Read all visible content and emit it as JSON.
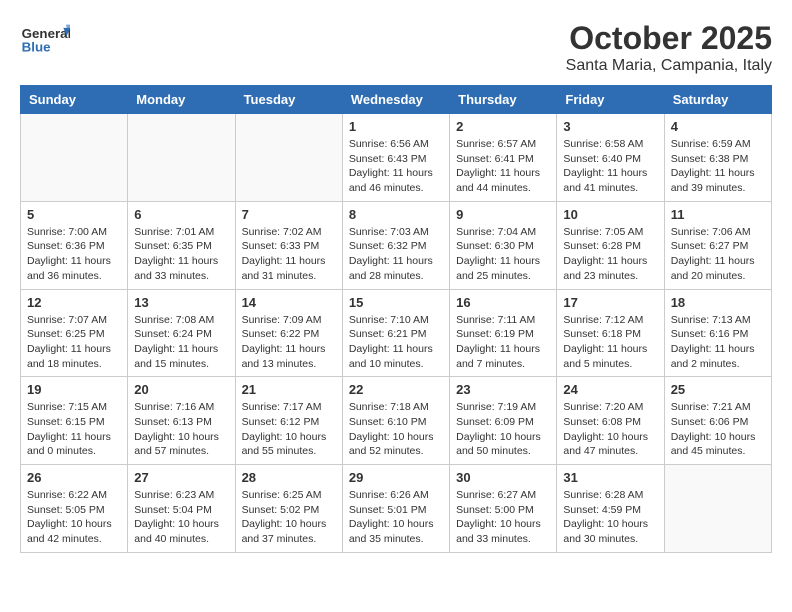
{
  "header": {
    "logo_general": "General",
    "logo_blue": "Blue",
    "title": "October 2025",
    "subtitle": "Santa Maria, Campania, Italy"
  },
  "weekdays": [
    "Sunday",
    "Monday",
    "Tuesday",
    "Wednesday",
    "Thursday",
    "Friday",
    "Saturday"
  ],
  "weeks": [
    [
      {
        "day": "",
        "info": ""
      },
      {
        "day": "",
        "info": ""
      },
      {
        "day": "",
        "info": ""
      },
      {
        "day": "1",
        "info": "Sunrise: 6:56 AM\nSunset: 6:43 PM\nDaylight: 11 hours and 46 minutes."
      },
      {
        "day": "2",
        "info": "Sunrise: 6:57 AM\nSunset: 6:41 PM\nDaylight: 11 hours and 44 minutes."
      },
      {
        "day": "3",
        "info": "Sunrise: 6:58 AM\nSunset: 6:40 PM\nDaylight: 11 hours and 41 minutes."
      },
      {
        "day": "4",
        "info": "Sunrise: 6:59 AM\nSunset: 6:38 PM\nDaylight: 11 hours and 39 minutes."
      }
    ],
    [
      {
        "day": "5",
        "info": "Sunrise: 7:00 AM\nSunset: 6:36 PM\nDaylight: 11 hours and 36 minutes."
      },
      {
        "day": "6",
        "info": "Sunrise: 7:01 AM\nSunset: 6:35 PM\nDaylight: 11 hours and 33 minutes."
      },
      {
        "day": "7",
        "info": "Sunrise: 7:02 AM\nSunset: 6:33 PM\nDaylight: 11 hours and 31 minutes."
      },
      {
        "day": "8",
        "info": "Sunrise: 7:03 AM\nSunset: 6:32 PM\nDaylight: 11 hours and 28 minutes."
      },
      {
        "day": "9",
        "info": "Sunrise: 7:04 AM\nSunset: 6:30 PM\nDaylight: 11 hours and 25 minutes."
      },
      {
        "day": "10",
        "info": "Sunrise: 7:05 AM\nSunset: 6:28 PM\nDaylight: 11 hours and 23 minutes."
      },
      {
        "day": "11",
        "info": "Sunrise: 7:06 AM\nSunset: 6:27 PM\nDaylight: 11 hours and 20 minutes."
      }
    ],
    [
      {
        "day": "12",
        "info": "Sunrise: 7:07 AM\nSunset: 6:25 PM\nDaylight: 11 hours and 18 minutes."
      },
      {
        "day": "13",
        "info": "Sunrise: 7:08 AM\nSunset: 6:24 PM\nDaylight: 11 hours and 15 minutes."
      },
      {
        "day": "14",
        "info": "Sunrise: 7:09 AM\nSunset: 6:22 PM\nDaylight: 11 hours and 13 minutes."
      },
      {
        "day": "15",
        "info": "Sunrise: 7:10 AM\nSunset: 6:21 PM\nDaylight: 11 hours and 10 minutes."
      },
      {
        "day": "16",
        "info": "Sunrise: 7:11 AM\nSunset: 6:19 PM\nDaylight: 11 hours and 7 minutes."
      },
      {
        "day": "17",
        "info": "Sunrise: 7:12 AM\nSunset: 6:18 PM\nDaylight: 11 hours and 5 minutes."
      },
      {
        "day": "18",
        "info": "Sunrise: 7:13 AM\nSunset: 6:16 PM\nDaylight: 11 hours and 2 minutes."
      }
    ],
    [
      {
        "day": "19",
        "info": "Sunrise: 7:15 AM\nSunset: 6:15 PM\nDaylight: 11 hours and 0 minutes."
      },
      {
        "day": "20",
        "info": "Sunrise: 7:16 AM\nSunset: 6:13 PM\nDaylight: 10 hours and 57 minutes."
      },
      {
        "day": "21",
        "info": "Sunrise: 7:17 AM\nSunset: 6:12 PM\nDaylight: 10 hours and 55 minutes."
      },
      {
        "day": "22",
        "info": "Sunrise: 7:18 AM\nSunset: 6:10 PM\nDaylight: 10 hours and 52 minutes."
      },
      {
        "day": "23",
        "info": "Sunrise: 7:19 AM\nSunset: 6:09 PM\nDaylight: 10 hours and 50 minutes."
      },
      {
        "day": "24",
        "info": "Sunrise: 7:20 AM\nSunset: 6:08 PM\nDaylight: 10 hours and 47 minutes."
      },
      {
        "day": "25",
        "info": "Sunrise: 7:21 AM\nSunset: 6:06 PM\nDaylight: 10 hours and 45 minutes."
      }
    ],
    [
      {
        "day": "26",
        "info": "Sunrise: 6:22 AM\nSunset: 5:05 PM\nDaylight: 10 hours and 42 minutes."
      },
      {
        "day": "27",
        "info": "Sunrise: 6:23 AM\nSunset: 5:04 PM\nDaylight: 10 hours and 40 minutes."
      },
      {
        "day": "28",
        "info": "Sunrise: 6:25 AM\nSunset: 5:02 PM\nDaylight: 10 hours and 37 minutes."
      },
      {
        "day": "29",
        "info": "Sunrise: 6:26 AM\nSunset: 5:01 PM\nDaylight: 10 hours and 35 minutes."
      },
      {
        "day": "30",
        "info": "Sunrise: 6:27 AM\nSunset: 5:00 PM\nDaylight: 10 hours and 33 minutes."
      },
      {
        "day": "31",
        "info": "Sunrise: 6:28 AM\nSunset: 4:59 PM\nDaylight: 10 hours and 30 minutes."
      },
      {
        "day": "",
        "info": ""
      }
    ]
  ]
}
